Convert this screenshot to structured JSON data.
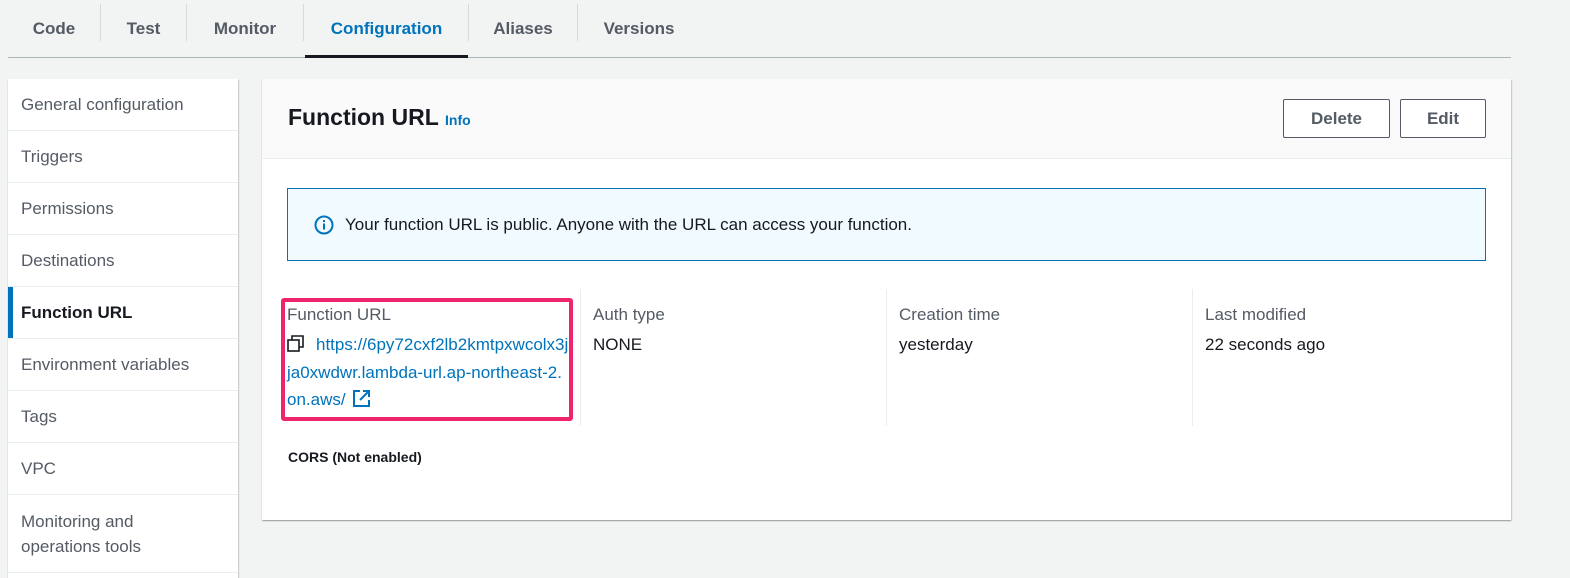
{
  "tabs": [
    {
      "label": "Code"
    },
    {
      "label": "Test"
    },
    {
      "label": "Monitor"
    },
    {
      "label": "Configuration",
      "active": true
    },
    {
      "label": "Aliases"
    },
    {
      "label": "Versions"
    }
  ],
  "sidenav": {
    "items": [
      {
        "label": "General configuration"
      },
      {
        "label": "Triggers"
      },
      {
        "label": "Permissions"
      },
      {
        "label": "Destinations"
      },
      {
        "label": "Function URL",
        "active": true
      },
      {
        "label": "Environment variables"
      },
      {
        "label": "Tags"
      },
      {
        "label": "VPC"
      },
      {
        "label": "Monitoring and operations tools"
      }
    ]
  },
  "panel": {
    "title": "Function URL",
    "info_label": "Info",
    "delete_label": "Delete",
    "edit_label": "Edit",
    "alert_text": "Your function URL is public. Anyone with the URL can access your function.",
    "details": {
      "url_label": "Function URL",
      "url_value": "https://6py72cxf2lb2kmtpxwcolx3jja0xwdwr.lambda-url.ap-northeast-2.on.aws/",
      "auth_label": "Auth type",
      "auth_value": "NONE",
      "creation_label": "Creation time",
      "creation_value": "yesterday",
      "modified_label": "Last modified",
      "modified_value": "22 seconds ago"
    },
    "cors_label": "CORS (Not enabled)"
  },
  "colors": {
    "accent": "#0073bb",
    "highlight": "#f0246c",
    "alert_bg": "#f1faff"
  },
  "icons": [
    "info-circle-icon",
    "copy-icon",
    "external-link-icon"
  ]
}
